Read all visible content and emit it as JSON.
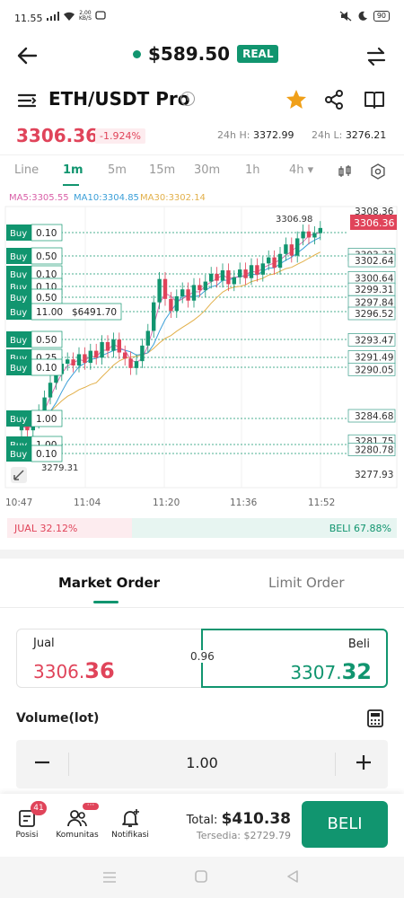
{
  "status_bar": {
    "time": "11.55",
    "net_speed_value": "2,00",
    "net_speed_unit": "KB/S",
    "battery": "90"
  },
  "header": {
    "balance": "$589.50",
    "account_type": "REAL"
  },
  "pair": {
    "name": "ETH/USDT Pro",
    "last_price": "3306.36",
    "change_pct": "-1.924%",
    "high_label": "24h H:",
    "high": "3372.99",
    "low_label": "24h L:",
    "low": "3276.21"
  },
  "timeframes": [
    "Line",
    "1m",
    "5m",
    "15m",
    "30m",
    "1h",
    "4h ▾"
  ],
  "active_timeframe": "1m",
  "chart": {
    "ma5": "MA5:3305.55",
    "ma10": "MA10:3304.85",
    "ma30": "MA30:3302.14",
    "high_marker": "3306.98",
    "low_marker": "3279.31",
    "current_price_tag": "3306.36",
    "price_labels": [
      "3308.36",
      "3303.33",
      "3302.64",
      "3300.64",
      "3299.31",
      "3297.84",
      "3296.52",
      "3293.47",
      "3291.49",
      "3290.05",
      "3284.68",
      "3281.75",
      "3280.78",
      "3277.93"
    ],
    "time_labels": [
      "10:47",
      "11:04",
      "11:20",
      "11:36",
      "11:52"
    ],
    "positions": [
      {
        "side": "Buy",
        "lot": "0.10"
      },
      {
        "side": "Buy",
        "lot": "0.50"
      },
      {
        "side": "Buy",
        "lot": "0.10"
      },
      {
        "side": "Buy",
        "lot": "0.10"
      },
      {
        "side": "Buy",
        "lot": "0.50"
      },
      {
        "side": "Buy",
        "lot": "11.00",
        "pnl": "$6491.70"
      },
      {
        "side": "Buy",
        "lot": "0.50"
      },
      {
        "side": "Buy",
        "lot": "0.25"
      },
      {
        "side": "Buy",
        "lot": "0.10"
      },
      {
        "side": "Buy",
        "lot": "1.00"
      },
      {
        "side": "Buy",
        "lot": "1.00"
      },
      {
        "side": "Buy",
        "lot": "0.10"
      }
    ]
  },
  "sentiment": {
    "jual": "JUAL 32.12%",
    "beli": "BELI 67.88%",
    "jual_fraction": 0.3212
  },
  "order_tabs": {
    "market": "Market Order",
    "limit": "Limit Order"
  },
  "quote": {
    "jual_label": "Jual",
    "jual_main": "3306.",
    "jual_tail": "36",
    "beli_label": "Beli",
    "beli_main": "3307.",
    "beli_tail": "32",
    "spread": "0.96"
  },
  "volume": {
    "label": "Volume(lot)",
    "value": "1.00"
  },
  "bottom": {
    "posisi": "Posisi",
    "posisi_badge": "41",
    "komunitas": "Komunitas",
    "notifikasi": "Notifikasi",
    "total_label": "Total:",
    "total_value": "$410.38",
    "tersedia": "Tersedia: $2729.79",
    "beli_button": "BELI"
  },
  "colors": {
    "green": "#11956f",
    "red": "#e0445a"
  }
}
